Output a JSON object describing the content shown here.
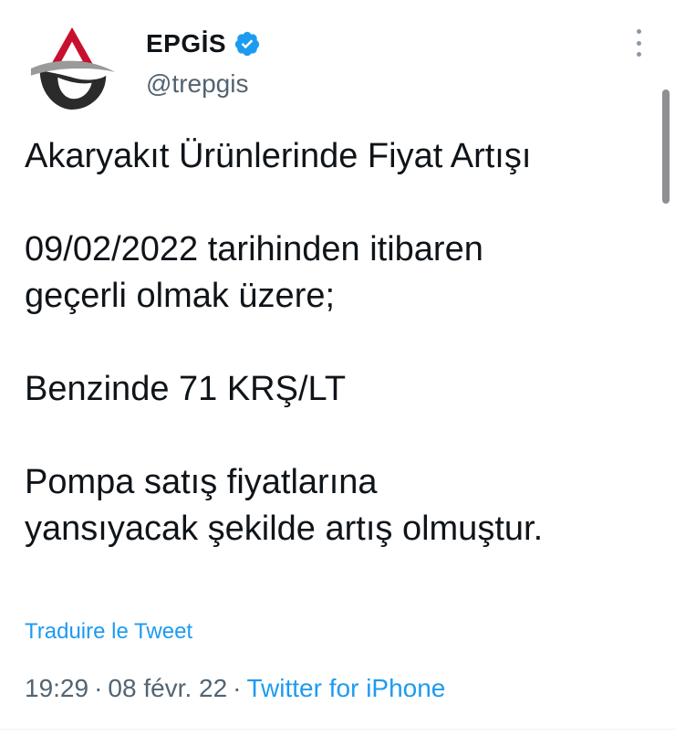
{
  "author": {
    "display_name": "EPGİS",
    "handle": "@trepgis",
    "verified": true,
    "avatar_icon": "epgis-logo-icon"
  },
  "tweet": {
    "lines": [
      "Akaryakıt Ürünlerinde Fiyat Artışı",
      "",
      "09/02/2022 tarihinden itibaren",
      "geçerli olmak üzere;",
      "",
      "Benzinde 71 KRŞ/LT",
      "",
      "Pompa satış fiyatlarına",
      "yansıyacak şekilde artış olmuştur."
    ],
    "translate_label": "Traduire le Tweet",
    "time": "19:29",
    "date": "08 févr. 22",
    "source": "Twitter for iPhone",
    "separator": "·"
  },
  "colors": {
    "link": "#1d9bf0",
    "secondary_text": "#536471",
    "logo_red": "#c8102e",
    "logo_dark": "#2b2b2b"
  }
}
